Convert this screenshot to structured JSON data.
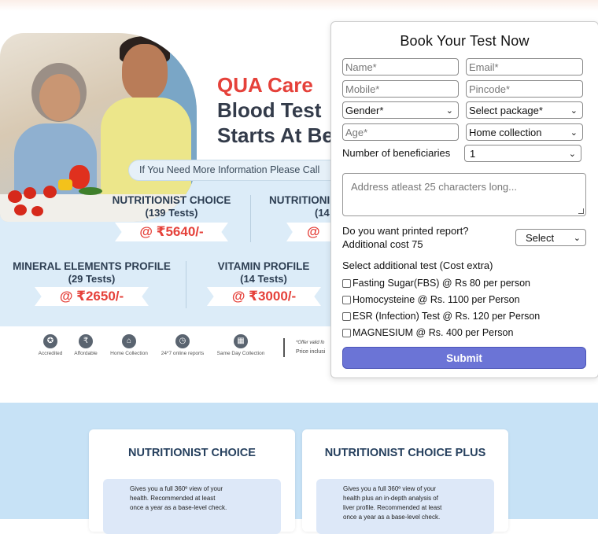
{
  "banner": {
    "brand": "QUA Care",
    "headline_line2": "Blood Test",
    "headline_line3": "Starts At Be",
    "info_text": "If You Need More Information Please Call",
    "packages": [
      {
        "name": "NUTRITIONIST CHOICE",
        "count": "(139 Tests)",
        "price": "@ ₹5640/-"
      },
      {
        "name": "NUTRITIONI",
        "count": "(14",
        "price": "@ ₹"
      },
      {
        "name": "MINERAL ELEMENTS PROFILE",
        "count": "(29 Tests)",
        "price": "@ ₹2650/-"
      },
      {
        "name": "VITAMIN PROFILE",
        "count": "(14 Tests)",
        "price": "@ ₹3000/-"
      }
    ],
    "features": [
      {
        "label": "Accredited",
        "icon": "award-icon"
      },
      {
        "label": "Affordable",
        "icon": "hand-money-icon"
      },
      {
        "label": "Home Collection",
        "icon": "home-icon"
      },
      {
        "label": "24*7 online reports",
        "icon": "clock-icon"
      },
      {
        "label": "Same Day Collection",
        "icon": "calendar-icon"
      }
    ],
    "offer_line1": "*Offer valid fo",
    "offer_line2": "Price inclusi"
  },
  "form": {
    "title": "Book Your Test Now",
    "name_placeholder": "Name*",
    "email_placeholder": "Email*",
    "mobile_placeholder": "Mobile*",
    "pincode_placeholder": "Pincode*",
    "gender_value": "Gender*",
    "package_value": "Select package*",
    "age_placeholder": "Age*",
    "collection_value": "Home collection",
    "beneficiaries_label": "Number of beneficiaries",
    "beneficiaries_value": "1",
    "address_placeholder": "Address atleast 25 characters long...",
    "printed_label": "Do you want printed report?",
    "printed_cost": "Additional cost 75",
    "printed_value": "Select",
    "additional_label": "Select additional test (Cost extra)",
    "additional_tests": [
      "Fasting Sugar(FBS) @ Rs 80 per person",
      "Homocysteine @ Rs. 1100 per Person",
      "ESR (Infection) Test @ Rs. 120 per Person",
      "MAGNESIUM @ Rs. 400 per Person"
    ],
    "submit_label": "Submit"
  },
  "cards": [
    {
      "title": "NUTRITIONIST CHOICE",
      "desc_lines": [
        "Gives you a full 360º view of your",
        "health. Recommended at least",
        "once a year as a base-level check."
      ]
    },
    {
      "title": "NUTRITIONIST CHOICE PLUS",
      "desc_lines": [
        "Gives you a full 360º view of your",
        "health plus an in-depth analysis of",
        "liver profile. Recommended at least",
        "once a year as a base-level check."
      ]
    }
  ]
}
